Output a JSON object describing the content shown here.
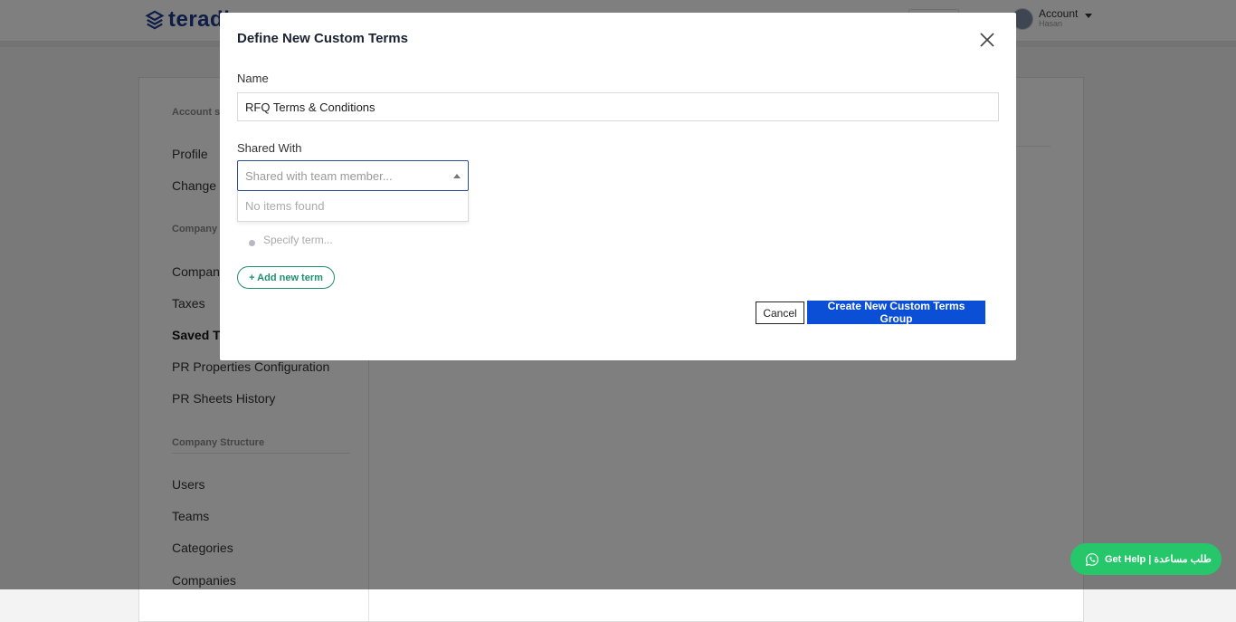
{
  "header": {
    "brand": "teradi",
    "account_label": "Account",
    "account_sub": "Hasan"
  },
  "sidebar": {
    "section_account": "Account s",
    "section_company": "Company",
    "section_structure": "Company Structure",
    "items": {
      "profile": "Profile",
      "change": "Change P",
      "company": "Company",
      "taxes": "Taxes",
      "saved_terms": "Saved Te",
      "pr_properties": "PR Properties Configuration",
      "pr_sheets": "PR Sheets History",
      "users": "Users",
      "teams": "Teams",
      "categories": "Categories",
      "companies": "Companies"
    }
  },
  "modal": {
    "title": "Define New Custom Terms",
    "name_label": "Name",
    "name_value": "RFQ Terms & Conditions",
    "shared_label": "Shared With",
    "shared_placeholder": "Shared with team member...",
    "dropdown_empty": "No items found",
    "term_placeholder": "Specify term...",
    "add_term": "+ Add new term",
    "cancel": "Cancel",
    "create": "Create New Custom Terms Group"
  },
  "help": {
    "label": "Get Help | طلب مساعدة"
  },
  "colors": {
    "brand": "#1a3a8a",
    "primary": "#0b4fd6",
    "accent_green": "#1f8f6f",
    "whatsapp": "#25c76a"
  }
}
